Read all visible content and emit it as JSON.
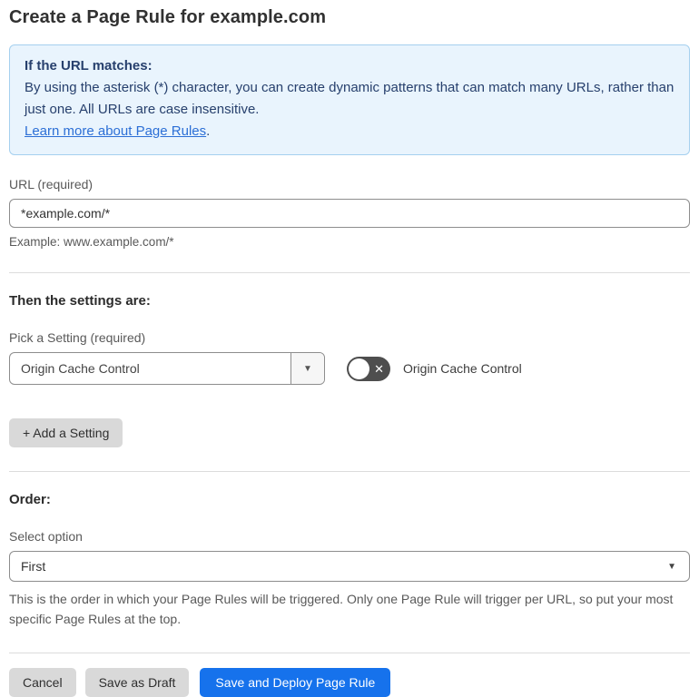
{
  "page": {
    "title": "Create a Page Rule for example.com"
  },
  "info_box": {
    "heading": "If the URL matches:",
    "body": "By using the asterisk (*) character, you can create dynamic patterns that can match many URLs, rather than just one. All URLs are case insensitive.",
    "link_text": "Learn more about Page Rules",
    "link_suffix": "."
  },
  "url_field": {
    "label": "URL (required)",
    "value": "*example.com/*",
    "example": "Example: www.example.com/*"
  },
  "settings_section": {
    "heading": "Then the settings are:",
    "picker_label": "Pick a Setting (required)",
    "picker_value": "Origin Cache Control",
    "toggle_state": "off",
    "toggle_glyph": "✕",
    "toggle_label": "Origin Cache Control",
    "add_setting_label": "+ Add a Setting"
  },
  "order_section": {
    "heading": "Order:",
    "select_label": "Select option",
    "select_value": "First",
    "help_text": "This is the order in which your Page Rules will be triggered. Only one Page Rule will trigger per URL, so put your most specific Page Rules at the top."
  },
  "footer": {
    "cancel_label": "Cancel",
    "save_draft_label": "Save as Draft",
    "save_deploy_label": "Save and Deploy Page Rule"
  },
  "icons": {
    "dropdown_caret": "▼"
  },
  "colors": {
    "primary_blue": "#1672ec",
    "info_bg": "#e9f4fd",
    "info_border": "#a5d0ef",
    "info_text": "#27406d",
    "link_blue": "#2c6fd6",
    "toggle_off_bg": "#4e4e4e",
    "gray_button_bg": "#d9d9d9",
    "input_border": "#8d8d8d"
  }
}
